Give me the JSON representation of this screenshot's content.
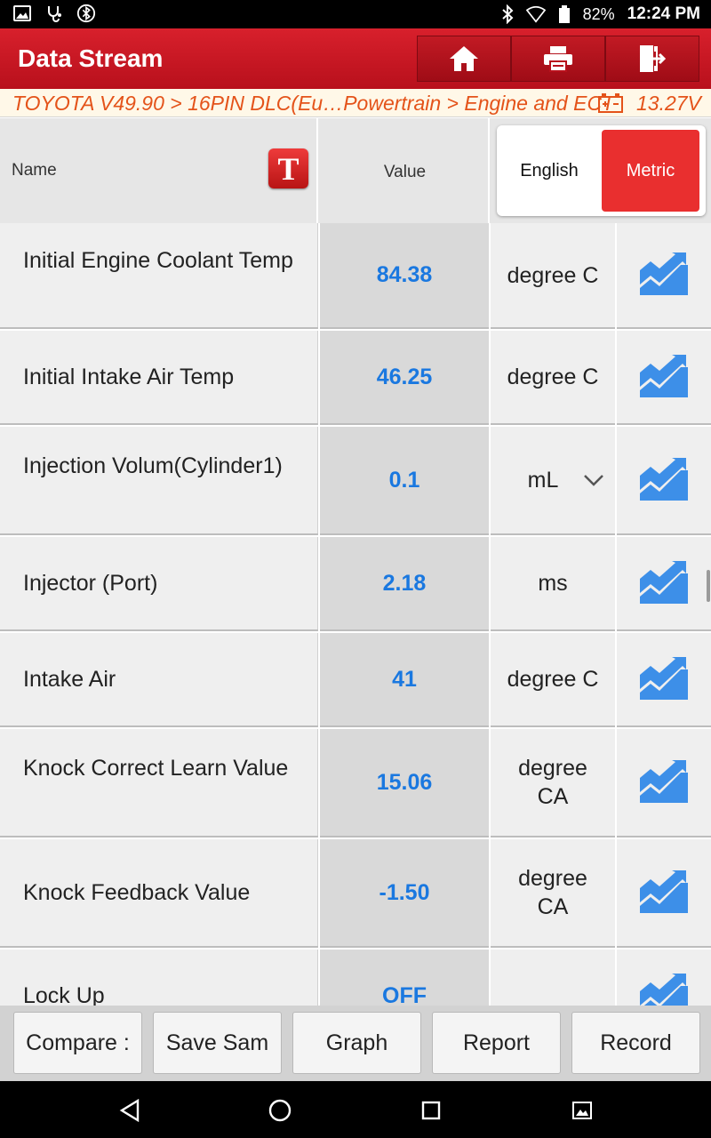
{
  "status_bar": {
    "battery_percent": "82%",
    "time": "12:24 PM",
    "left_icons": [
      "image-icon",
      "stethoscope-icon",
      "bluetooth-circle-icon"
    ],
    "right_icons": [
      "bluetooth-icon",
      "wifi-icon",
      "battery-icon"
    ]
  },
  "header": {
    "title": "Data Stream",
    "buttons": [
      "home-icon",
      "print-icon",
      "exit-icon"
    ]
  },
  "breadcrumb": {
    "path": "TOYOTA V49.90 > 16PIN DLC(Eu…Powertrain > Engine and ECT",
    "voltage": "13.27V",
    "accent_color": "#e4531a"
  },
  "table_header": {
    "name_label": "Name",
    "value_label": "Value",
    "logo_letter": "T",
    "unit_toggle": {
      "english": "English",
      "metric": "Metric",
      "selected": "Metric"
    }
  },
  "rows": [
    {
      "name": "Initial Engine Coolant Temp",
      "value": "84.38",
      "unit": "degree C"
    },
    {
      "name": "Initial Intake Air Temp",
      "value": "46.25",
      "unit": "degree C"
    },
    {
      "name": "Injection Volum(Cylinder1)",
      "value": "0.1",
      "unit": "mL",
      "unit_dropdown": true
    },
    {
      "name": "Injector (Port)",
      "value": "2.18",
      "unit": "ms"
    },
    {
      "name": "Intake Air",
      "value": "41",
      "unit": "degree C"
    },
    {
      "name": "Knock Correct Learn Value",
      "value": "15.06",
      "unit": "degree CA"
    },
    {
      "name": "Knock Feedback Value",
      "value": "-1.50",
      "unit": "degree CA"
    },
    {
      "name": "Lock Up",
      "value": "OFF",
      "unit": ""
    }
  ],
  "toolbar": {
    "compare": "Compare :",
    "save_sample": "Save Sam",
    "graph": "Graph",
    "report": "Report",
    "record": "Record"
  },
  "colors": {
    "brand_red": "#d01c28",
    "value_blue": "#1a78e0",
    "metric_active": "#e92f2f"
  }
}
